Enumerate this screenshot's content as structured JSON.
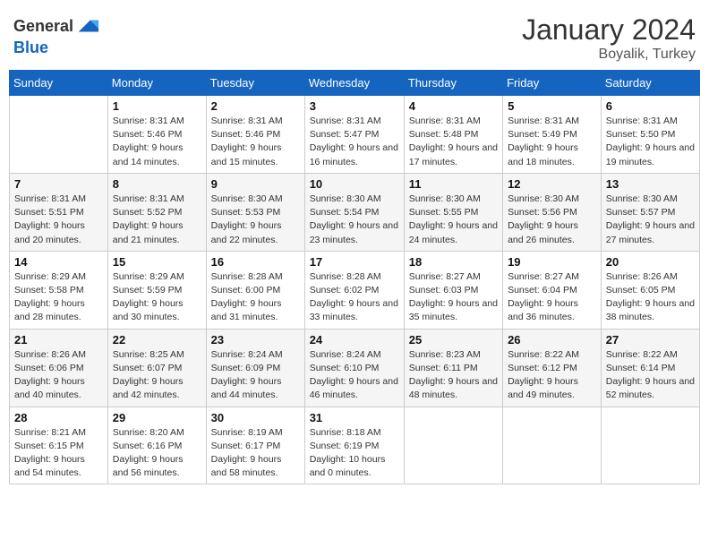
{
  "header": {
    "logo_general": "General",
    "logo_blue": "Blue",
    "month": "January 2024",
    "location": "Boyalik, Turkey"
  },
  "weekdays": [
    "Sunday",
    "Monday",
    "Tuesday",
    "Wednesday",
    "Thursday",
    "Friday",
    "Saturday"
  ],
  "weeks": [
    [
      {
        "day": "",
        "sunrise": "",
        "sunset": "",
        "daylight": ""
      },
      {
        "day": "1",
        "sunrise": "Sunrise: 8:31 AM",
        "sunset": "Sunset: 5:46 PM",
        "daylight": "Daylight: 9 hours and 14 minutes."
      },
      {
        "day": "2",
        "sunrise": "Sunrise: 8:31 AM",
        "sunset": "Sunset: 5:46 PM",
        "daylight": "Daylight: 9 hours and 15 minutes."
      },
      {
        "day": "3",
        "sunrise": "Sunrise: 8:31 AM",
        "sunset": "Sunset: 5:47 PM",
        "daylight": "Daylight: 9 hours and 16 minutes."
      },
      {
        "day": "4",
        "sunrise": "Sunrise: 8:31 AM",
        "sunset": "Sunset: 5:48 PM",
        "daylight": "Daylight: 9 hours and 17 minutes."
      },
      {
        "day": "5",
        "sunrise": "Sunrise: 8:31 AM",
        "sunset": "Sunset: 5:49 PM",
        "daylight": "Daylight: 9 hours and 18 minutes."
      },
      {
        "day": "6",
        "sunrise": "Sunrise: 8:31 AM",
        "sunset": "Sunset: 5:50 PM",
        "daylight": "Daylight: 9 hours and 19 minutes."
      }
    ],
    [
      {
        "day": "7",
        "sunrise": "Sunrise: 8:31 AM",
        "sunset": "Sunset: 5:51 PM",
        "daylight": "Daylight: 9 hours and 20 minutes."
      },
      {
        "day": "8",
        "sunrise": "Sunrise: 8:31 AM",
        "sunset": "Sunset: 5:52 PM",
        "daylight": "Daylight: 9 hours and 21 minutes."
      },
      {
        "day": "9",
        "sunrise": "Sunrise: 8:30 AM",
        "sunset": "Sunset: 5:53 PM",
        "daylight": "Daylight: 9 hours and 22 minutes."
      },
      {
        "day": "10",
        "sunrise": "Sunrise: 8:30 AM",
        "sunset": "Sunset: 5:54 PM",
        "daylight": "Daylight: 9 hours and 23 minutes."
      },
      {
        "day": "11",
        "sunrise": "Sunrise: 8:30 AM",
        "sunset": "Sunset: 5:55 PM",
        "daylight": "Daylight: 9 hours and 24 minutes."
      },
      {
        "day": "12",
        "sunrise": "Sunrise: 8:30 AM",
        "sunset": "Sunset: 5:56 PM",
        "daylight": "Daylight: 9 hours and 26 minutes."
      },
      {
        "day": "13",
        "sunrise": "Sunrise: 8:30 AM",
        "sunset": "Sunset: 5:57 PM",
        "daylight": "Daylight: 9 hours and 27 minutes."
      }
    ],
    [
      {
        "day": "14",
        "sunrise": "Sunrise: 8:29 AM",
        "sunset": "Sunset: 5:58 PM",
        "daylight": "Daylight: 9 hours and 28 minutes."
      },
      {
        "day": "15",
        "sunrise": "Sunrise: 8:29 AM",
        "sunset": "Sunset: 5:59 PM",
        "daylight": "Daylight: 9 hours and 30 minutes."
      },
      {
        "day": "16",
        "sunrise": "Sunrise: 8:28 AM",
        "sunset": "Sunset: 6:00 PM",
        "daylight": "Daylight: 9 hours and 31 minutes."
      },
      {
        "day": "17",
        "sunrise": "Sunrise: 8:28 AM",
        "sunset": "Sunset: 6:02 PM",
        "daylight": "Daylight: 9 hours and 33 minutes."
      },
      {
        "day": "18",
        "sunrise": "Sunrise: 8:27 AM",
        "sunset": "Sunset: 6:03 PM",
        "daylight": "Daylight: 9 hours and 35 minutes."
      },
      {
        "day": "19",
        "sunrise": "Sunrise: 8:27 AM",
        "sunset": "Sunset: 6:04 PM",
        "daylight": "Daylight: 9 hours and 36 minutes."
      },
      {
        "day": "20",
        "sunrise": "Sunrise: 8:26 AM",
        "sunset": "Sunset: 6:05 PM",
        "daylight": "Daylight: 9 hours and 38 minutes."
      }
    ],
    [
      {
        "day": "21",
        "sunrise": "Sunrise: 8:26 AM",
        "sunset": "Sunset: 6:06 PM",
        "daylight": "Daylight: 9 hours and 40 minutes."
      },
      {
        "day": "22",
        "sunrise": "Sunrise: 8:25 AM",
        "sunset": "Sunset: 6:07 PM",
        "daylight": "Daylight: 9 hours and 42 minutes."
      },
      {
        "day": "23",
        "sunrise": "Sunrise: 8:24 AM",
        "sunset": "Sunset: 6:09 PM",
        "daylight": "Daylight: 9 hours and 44 minutes."
      },
      {
        "day": "24",
        "sunrise": "Sunrise: 8:24 AM",
        "sunset": "Sunset: 6:10 PM",
        "daylight": "Daylight: 9 hours and 46 minutes."
      },
      {
        "day": "25",
        "sunrise": "Sunrise: 8:23 AM",
        "sunset": "Sunset: 6:11 PM",
        "daylight": "Daylight: 9 hours and 48 minutes."
      },
      {
        "day": "26",
        "sunrise": "Sunrise: 8:22 AM",
        "sunset": "Sunset: 6:12 PM",
        "daylight": "Daylight: 9 hours and 49 minutes."
      },
      {
        "day": "27",
        "sunrise": "Sunrise: 8:22 AM",
        "sunset": "Sunset: 6:14 PM",
        "daylight": "Daylight: 9 hours and 52 minutes."
      }
    ],
    [
      {
        "day": "28",
        "sunrise": "Sunrise: 8:21 AM",
        "sunset": "Sunset: 6:15 PM",
        "daylight": "Daylight: 9 hours and 54 minutes."
      },
      {
        "day": "29",
        "sunrise": "Sunrise: 8:20 AM",
        "sunset": "Sunset: 6:16 PM",
        "daylight": "Daylight: 9 hours and 56 minutes."
      },
      {
        "day": "30",
        "sunrise": "Sunrise: 8:19 AM",
        "sunset": "Sunset: 6:17 PM",
        "daylight": "Daylight: 9 hours and 58 minutes."
      },
      {
        "day": "31",
        "sunrise": "Sunrise: 8:18 AM",
        "sunset": "Sunset: 6:19 PM",
        "daylight": "Daylight: 10 hours and 0 minutes."
      },
      {
        "day": "",
        "sunrise": "",
        "sunset": "",
        "daylight": ""
      },
      {
        "day": "",
        "sunrise": "",
        "sunset": "",
        "daylight": ""
      },
      {
        "day": "",
        "sunrise": "",
        "sunset": "",
        "daylight": ""
      }
    ]
  ]
}
